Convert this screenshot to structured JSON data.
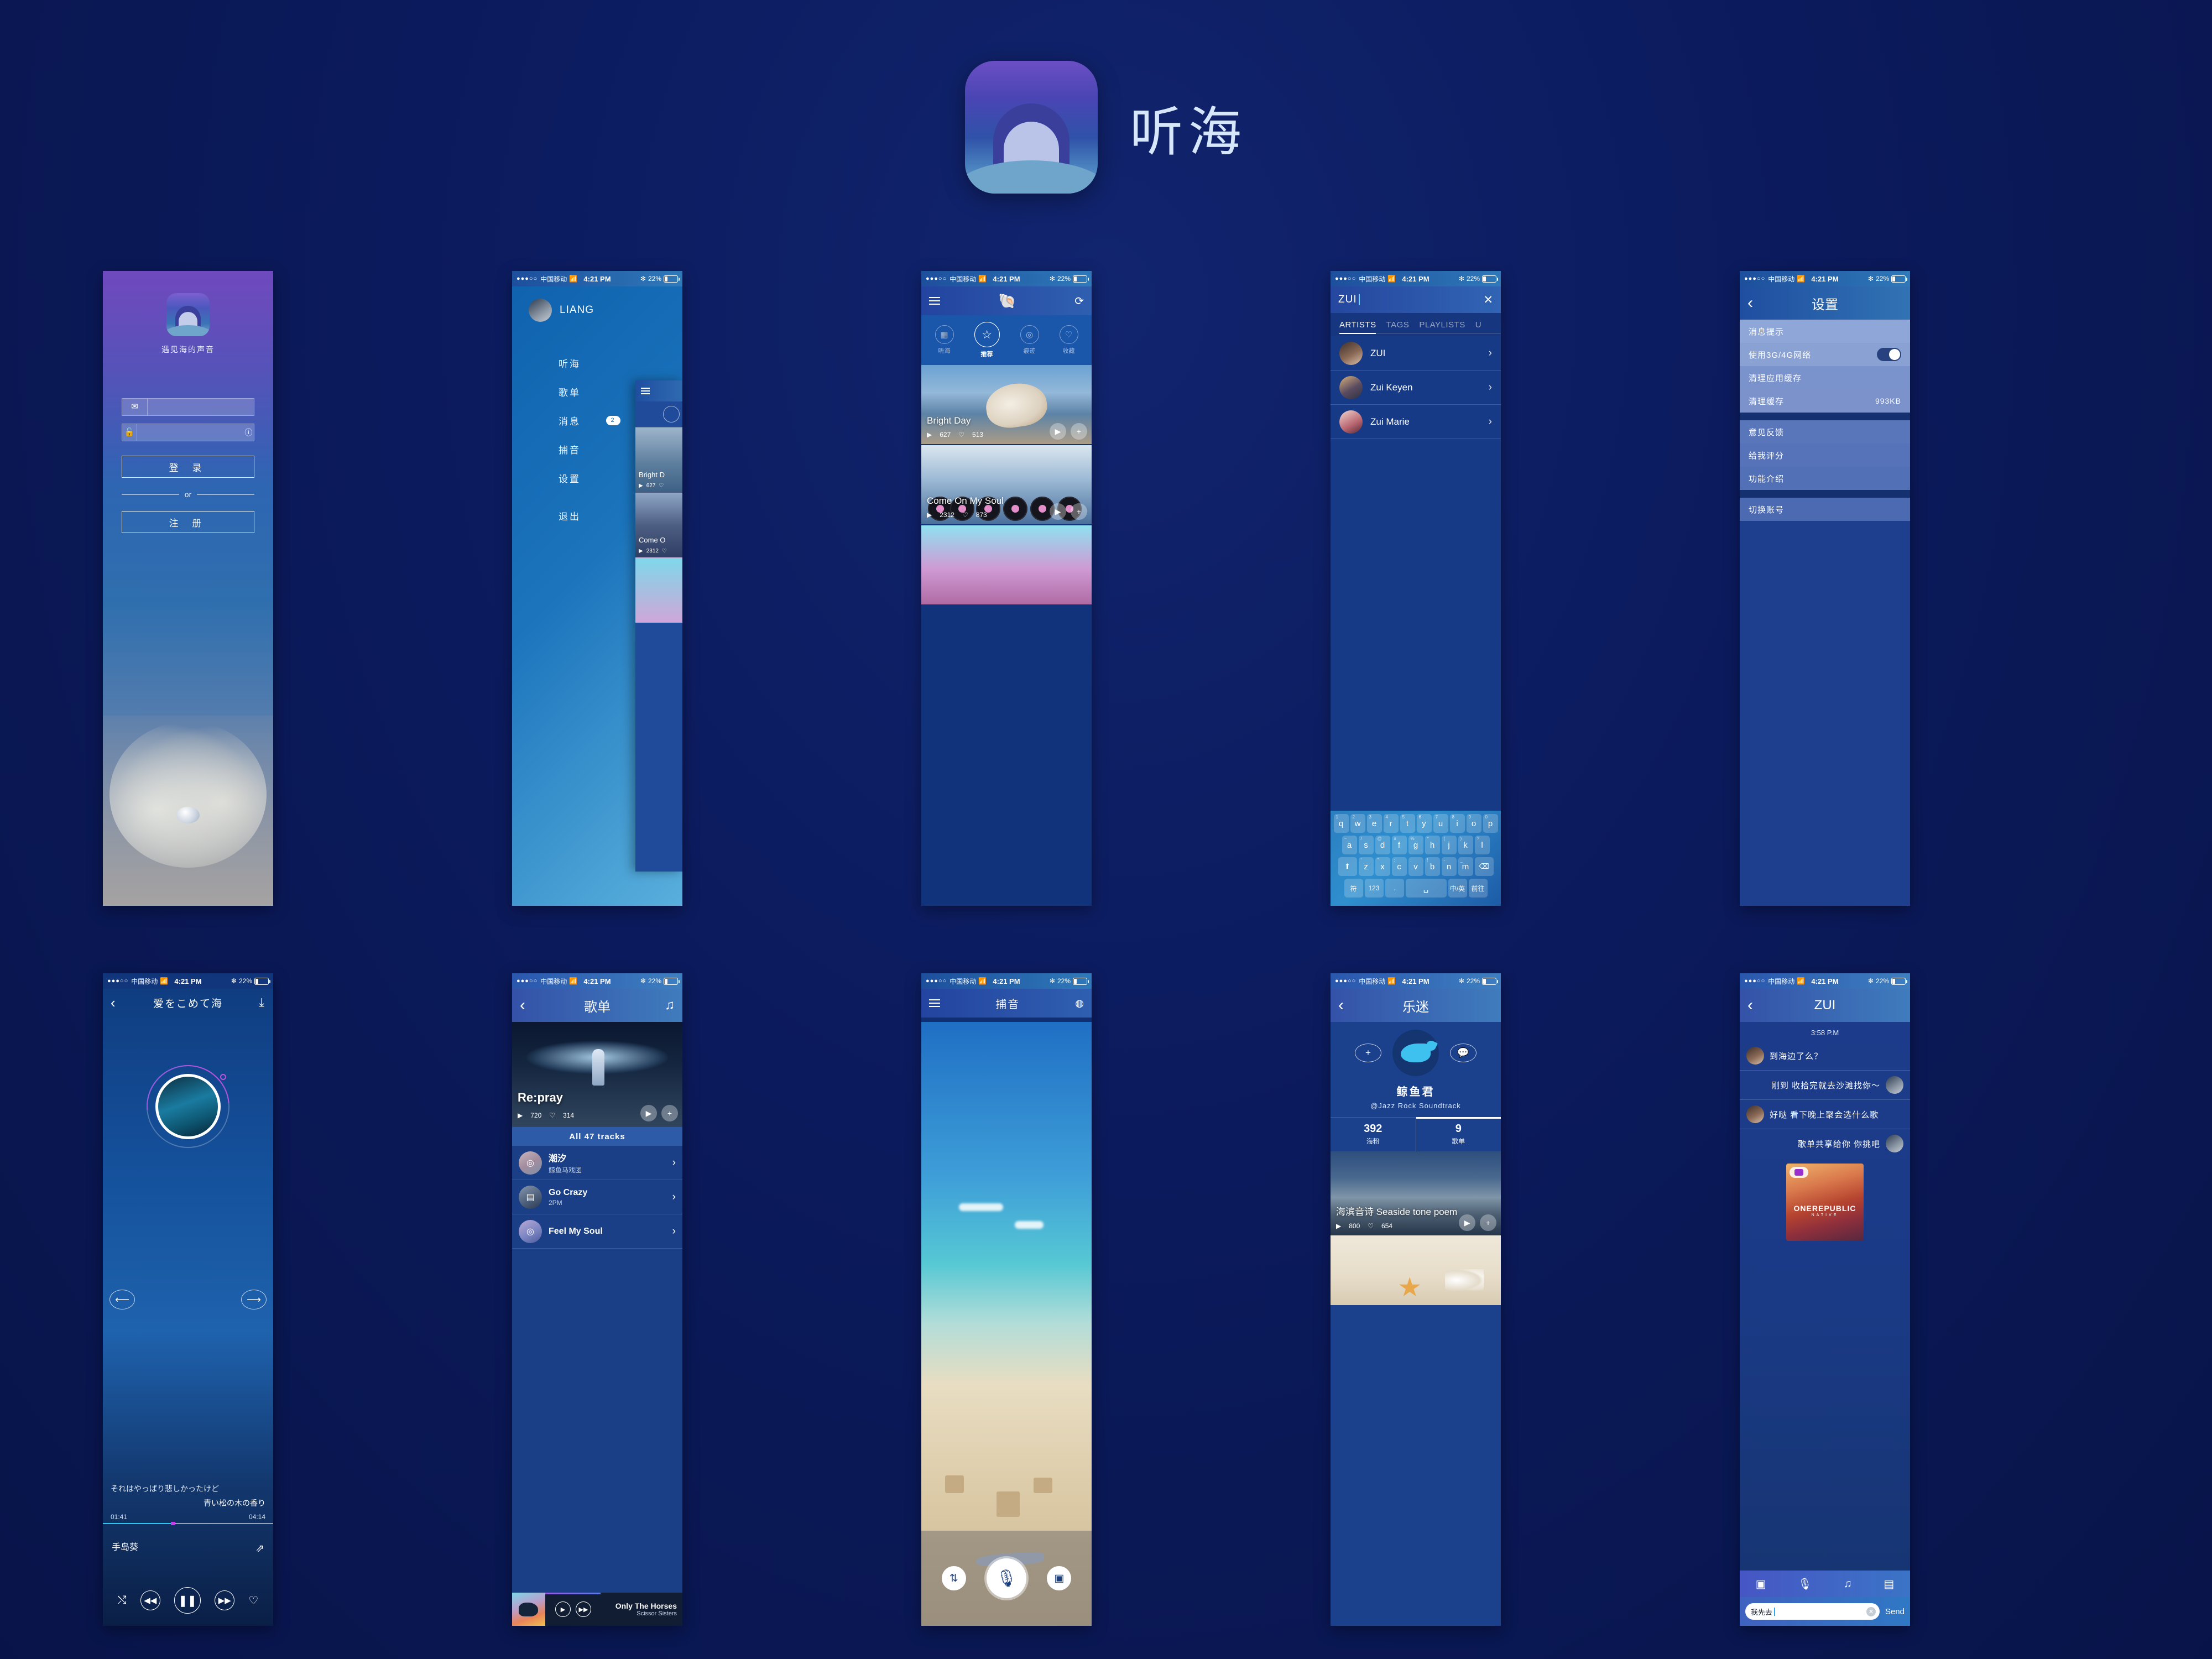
{
  "app": {
    "title": "听海",
    "logo_icon": "shell-pearl-icon"
  },
  "status_bar": {
    "dots": "●●●○○",
    "carrier": "中国移动",
    "wifi_icon": "wifi-icon",
    "time": "4:21 PM",
    "bluetooth_icon": "bluetooth-icon",
    "battery": "22%"
  },
  "login": {
    "tagline": "遇见海的声音",
    "email_icon": "envelope-icon",
    "email_value": "",
    "email_placeholder": "",
    "lock_icon": "lock-icon",
    "password_value": "",
    "password_placeholder": "",
    "info_icon": "info-icon",
    "login_label": "登 录",
    "or_label": "or",
    "register_label": "注 册"
  },
  "drawer": {
    "user": "LIANG",
    "avatar_icon": "avatar-icon",
    "items": [
      {
        "label": "听海"
      },
      {
        "label": "歌单"
      },
      {
        "label": "消息",
        "badge": "2"
      },
      {
        "label": "捕音"
      },
      {
        "label": "设置"
      }
    ],
    "exit": "退出",
    "peek": {
      "menu_icon": "hamburger-icon",
      "cards": [
        {
          "title": "Bright D",
          "plays": "627"
        },
        {
          "title": "Come O",
          "plays": "2312"
        }
      ]
    }
  },
  "home": {
    "menu_icon": "hamburger-icon",
    "shell_icon": "shell-icon",
    "refresh_icon": "refresh-icon",
    "tabs": [
      {
        "label": "听海",
        "icon": "grid-icon",
        "active": false
      },
      {
        "label": "推荐",
        "icon": "star-icon",
        "active": true
      },
      {
        "label": "痕迹",
        "icon": "vinyl-icon",
        "active": false
      },
      {
        "label": "收藏",
        "icon": "heart-icon",
        "active": false
      }
    ],
    "cards": [
      {
        "title": "Bright Day",
        "plays": "627",
        "likes": "513",
        "play_icon": "play-icon",
        "add_icon": "plus-icon"
      },
      {
        "title": "Come On My Soul",
        "plays": "2312",
        "likes": "873",
        "play_icon": "play-icon",
        "add_icon": "plus-icon"
      },
      {
        "title": "",
        "plays": "",
        "likes": ""
      }
    ]
  },
  "search": {
    "query": "ZUI",
    "clear_icon": "close-icon",
    "tabs": [
      {
        "label": "ARTISTS",
        "active": true
      },
      {
        "label": "TAGS",
        "active": false
      },
      {
        "label": "PLAYLISTS",
        "active": false
      },
      {
        "label": "U",
        "active": false
      }
    ],
    "results": [
      {
        "name": "ZUI",
        "chevron": "›"
      },
      {
        "name": "Zui Keyen",
        "chevron": "›"
      },
      {
        "name": "Zui Marie",
        "chevron": "›"
      }
    ],
    "keyboard": {
      "row1": [
        {
          "key": "q",
          "sup": "1"
        },
        {
          "key": "w",
          "sup": "2"
        },
        {
          "key": "e",
          "sup": "3"
        },
        {
          "key": "r",
          "sup": "4"
        },
        {
          "key": "t",
          "sup": "5"
        },
        {
          "key": "y",
          "sup": "6"
        },
        {
          "key": "u",
          "sup": "7"
        },
        {
          "key": "i",
          "sup": "8"
        },
        {
          "key": "o",
          "sup": "9"
        },
        {
          "key": "p",
          "sup": "0"
        }
      ],
      "row2": [
        {
          "key": "a",
          "sup": "~"
        },
        {
          "key": "s",
          "sup": "/"
        },
        {
          "key": "d",
          "sup": "@"
        },
        {
          "key": "f",
          "sup": "#"
        },
        {
          "key": "g",
          "sup": "%"
        },
        {
          "key": "h",
          "sup": "*"
        },
        {
          "key": "j",
          "sup": "("
        },
        {
          "key": "k",
          "sup": ")"
        },
        {
          "key": "l",
          "sup": "?"
        }
      ],
      "row3": [
        {
          "key": "⬆",
          "sup": ""
        },
        {
          "key": "z",
          "sup": "'"
        },
        {
          "key": "x",
          "sup": "\""
        },
        {
          "key": "c",
          "sup": ":"
        },
        {
          "key": "v",
          "sup": ";"
        },
        {
          "key": "b",
          "sup": "!"
        },
        {
          "key": "n",
          "sup": "-"
        },
        {
          "key": "m",
          "sup": "_"
        },
        {
          "key": "⌫",
          "sup": ""
        }
      ],
      "row4": [
        {
          "key": "符"
        },
        {
          "key": "123"
        },
        {
          "key": "."
        },
        {
          "key": "␣"
        },
        {
          "key": "中/英"
        },
        {
          "key": "前往"
        }
      ]
    }
  },
  "settings": {
    "back_icon": "chevron-left-icon",
    "title": "设置",
    "group1": [
      {
        "label": "消息提示",
        "value": "",
        "toggle": null
      },
      {
        "label": "使用3G/4G网络",
        "value": "",
        "toggle": true
      },
      {
        "label": "清理应用缓存",
        "value": "",
        "toggle": null
      },
      {
        "label": "清理缓存",
        "value": "993KB",
        "toggle": null
      }
    ],
    "group2": [
      {
        "label": "意见反馈"
      },
      {
        "label": "给我评分"
      },
      {
        "label": "功能介绍"
      }
    ],
    "group3": [
      {
        "label": "切换账号"
      }
    ]
  },
  "player": {
    "back_icon": "chevron-left-icon",
    "title": "爱をこめて海",
    "download_icon": "download-icon",
    "prev_icon": "arrow-left-icon",
    "next_icon": "arrow-right-icon",
    "lyric1": "それはやっぱり悲しかったけど",
    "lyric2": "青い松の木の香り",
    "elapsed": "01:41",
    "duration": "04:14",
    "artist": "手岛葵",
    "share_icon": "share-icon",
    "shuffle_icon": "shuffle-icon",
    "rewind_icon": "rewind-icon",
    "pause_icon": "pause-icon",
    "forward_icon": "forward-icon",
    "like_icon": "heart-icon"
  },
  "playlist": {
    "back_icon": "chevron-left-icon",
    "title": "歌单",
    "music_icon": "music-note-icon",
    "hero": {
      "title": "Re:pray",
      "plays": "720",
      "likes": "314",
      "play_icon": "play-icon",
      "add_icon": "plus-icon"
    },
    "all_label": "All  47 tracks",
    "tracks": [
      {
        "name": "潮汐",
        "artist": "鲸鱼马戏团",
        "icon": "vinyl-icon"
      },
      {
        "name": "Go Crazy",
        "artist": "2PM",
        "icon": "video-icon"
      },
      {
        "name": "Feel My Soul",
        "artist": "",
        "icon": "vinyl-icon"
      }
    ],
    "mini_player": {
      "title": "Only The Horses",
      "artist": "Scissor Sisters",
      "play_icon": "play-icon",
      "next_icon": "forward-icon"
    }
  },
  "capture": {
    "menu_icon": "hamburger-icon",
    "title": "捕音",
    "wave_icon": "waveform-icon",
    "settings_icon": "sliders-icon",
    "record_icon": "microphone-icon",
    "video_icon": "video-camera-icon"
  },
  "profile": {
    "back_icon": "chevron-left-icon",
    "title": "乐迷",
    "add_icon": "plus-icon",
    "message_icon": "chat-bubble-icon",
    "avatar_icon": "whale-icon",
    "name": "鲸鱼君",
    "tags": "@Jazz  Rock  Soundtrack",
    "stats": [
      {
        "num": "392",
        "label": "海粉",
        "active": false
      },
      {
        "num": "9",
        "label": "歌单",
        "active": true
      }
    ],
    "feed": [
      {
        "title": "海滨音诗 Seaside tone poem",
        "plays": "800",
        "likes": "654",
        "play_icon": "play-icon",
        "add_icon": "plus-icon"
      }
    ]
  },
  "chat": {
    "back_icon": "chevron-left-icon",
    "title": "ZUI",
    "timestamp": "3:58 P.M",
    "messages": [
      {
        "side": "them",
        "text": "到海边了么？"
      },
      {
        "side": "me",
        "text": "刚到 收拾完就去沙滩找你～"
      },
      {
        "side": "them",
        "text": "好哒  看下晚上聚会选什么歌"
      },
      {
        "side": "me",
        "text": "歌单共享给你  你挑吧"
      }
    ],
    "album": {
      "title": "ONEREPUBLIC",
      "subtitle": "NATIVE",
      "badge_icon": "camera-icon"
    },
    "tools": [
      {
        "icon": "camera-icon"
      },
      {
        "icon": "microphone-icon"
      },
      {
        "icon": "music-note-icon"
      },
      {
        "icon": "card-icon"
      }
    ],
    "input_value": "我先去",
    "clear_icon": "close-icon",
    "send_label": "Send"
  }
}
